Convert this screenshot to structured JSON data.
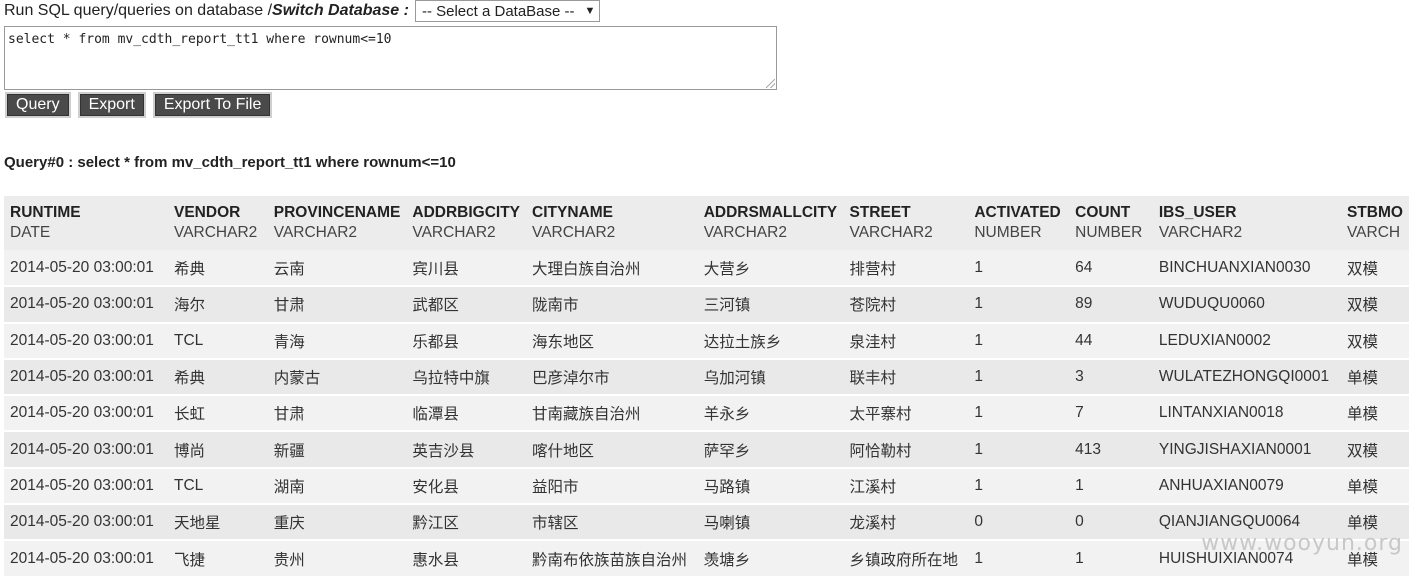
{
  "topbar": {
    "prefix": "Run SQL query/queries on database / ",
    "switch_label": "Switch Database :",
    "db_select_value": "-- Select a DataBase --",
    "arrow_glyph": "▼"
  },
  "editor": {
    "sql": "select * from mv_cdth_report_tt1 where rownum<=10"
  },
  "buttons": {
    "query": "Query",
    "export": "Export",
    "export_to_file": "Export To File"
  },
  "query_title": "Query#0 : select * from mv_cdth_report_tt1 where rownum<=10",
  "table": {
    "columns": [
      {
        "name": "RUNTIME",
        "type": "DATE"
      },
      {
        "name": "VENDOR",
        "type": "VARCHAR2"
      },
      {
        "name": "PROVINCENAME",
        "type": "VARCHAR2"
      },
      {
        "name": "ADDRBIGCITY",
        "type": "VARCHAR2"
      },
      {
        "name": "CITYNAME",
        "type": "VARCHAR2"
      },
      {
        "name": "ADDRSMALLCITY",
        "type": "VARCHAR2"
      },
      {
        "name": "STREET",
        "type": "VARCHAR2"
      },
      {
        "name": "ACTIVATED",
        "type": "NUMBER"
      },
      {
        "name": "COUNT",
        "type": "NUMBER"
      },
      {
        "name": "IBS_USER",
        "type": "VARCHAR2"
      },
      {
        "name": "STBMO",
        "type": "VARCH"
      }
    ],
    "rows": [
      [
        "2014-05-20 03:00:01",
        "希典",
        "云南",
        "宾川县",
        "大理白族自治州",
        "大营乡",
        "排营村",
        "1",
        "64",
        "BINCHUANXIAN0030",
        "双模"
      ],
      [
        "2014-05-20 03:00:01",
        "海尔",
        "甘肃",
        "武都区",
        "陇南市",
        "三河镇",
        "苍院村",
        "1",
        "89",
        "WUDUQU0060",
        "双模"
      ],
      [
        "2014-05-20 03:00:01",
        "TCL",
        "青海",
        "乐都县",
        "海东地区",
        "达拉土族乡",
        "泉洼村",
        "1",
        "44",
        "LEDUXIAN0002",
        "双模"
      ],
      [
        "2014-05-20 03:00:01",
        "希典",
        "内蒙古",
        "乌拉特中旗",
        "巴彦淖尔市",
        "乌加河镇",
        "联丰村",
        "1",
        "3",
        "WULATEZHONGQI0001",
        "单模"
      ],
      [
        "2014-05-20 03:00:01",
        "长虹",
        "甘肃",
        "临潭县",
        "甘南藏族自治州",
        "羊永乡",
        "太平寨村",
        "1",
        "7",
        "LINTANXIAN0018",
        "单模"
      ],
      [
        "2014-05-20 03:00:01",
        "博尚",
        "新疆",
        "英吉沙县",
        "喀什地区",
        "萨罕乡",
        "阿恰勒村",
        "1",
        "413",
        "YINGJISHAXIAN0001",
        "双模"
      ],
      [
        "2014-05-20 03:00:01",
        "TCL",
        "湖南",
        "安化县",
        "益阳市",
        "马路镇",
        "江溪村",
        "1",
        "1",
        "ANHUAXIAN0079",
        "单模"
      ],
      [
        "2014-05-20 03:00:01",
        "天地星",
        "重庆",
        "黔江区",
        "市辖区",
        "马喇镇",
        "龙溪村",
        "0",
        "0",
        "QIANJIANGQU0064",
        "单模"
      ],
      [
        "2014-05-20 03:00:01",
        "飞捷",
        "贵州",
        "惠水县",
        "黔南布依族苗族自治州",
        "羡塘乡",
        "乡镇政府所在地",
        "1",
        "1",
        "HUISHUIXIAN0074",
        "单模"
      ]
    ]
  },
  "watermark": "www.wooyun.org"
}
